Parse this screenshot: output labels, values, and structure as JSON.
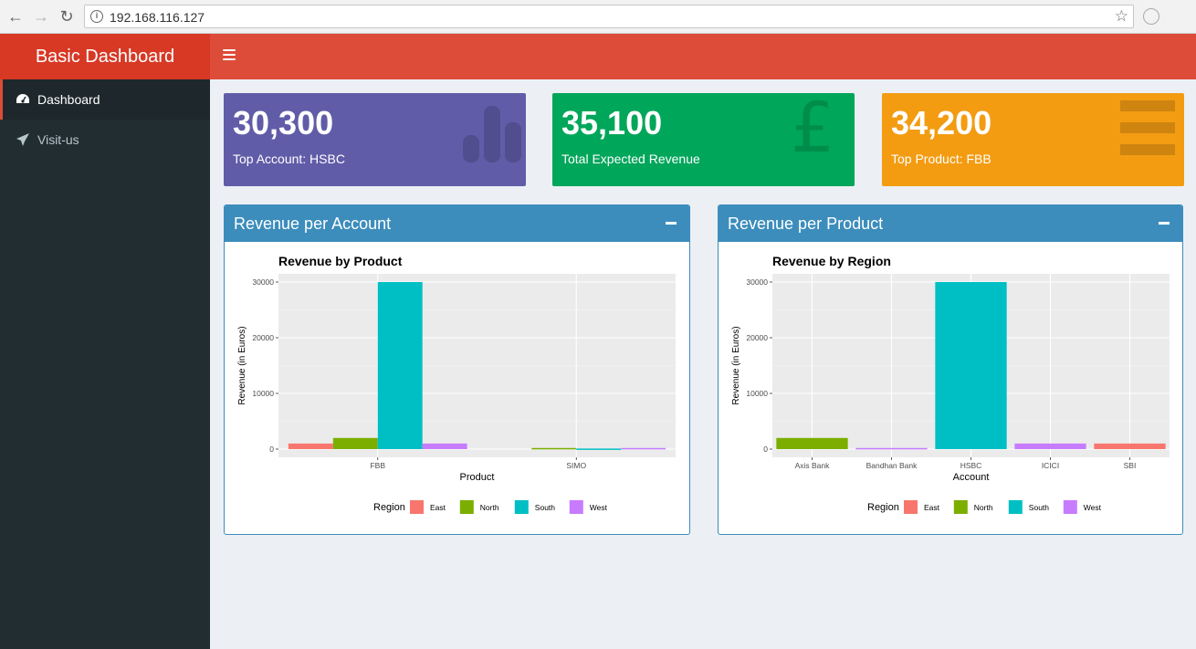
{
  "browser": {
    "url": "192.168.116.127"
  },
  "app": {
    "title": "Basic Dashboard"
  },
  "sidebar": {
    "items": [
      {
        "label": "Dashboard",
        "icon": "dashboard-icon",
        "active": true
      },
      {
        "label": "Visit-us",
        "icon": "paper-plane-icon",
        "active": false
      }
    ]
  },
  "value_boxes": [
    {
      "value": "30,300",
      "subtitle": "Top Account: HSBC",
      "color": "#605ca8",
      "icon": "bar-chart-icon"
    },
    {
      "value": "35,100",
      "subtitle": "Total Expected Revenue",
      "color": "#00a65a",
      "icon": "pound-icon"
    },
    {
      "value": "34,200",
      "subtitle": "Top Product: FBB",
      "color": "#f39c12",
      "icon": "menu-icon"
    }
  ],
  "panels": [
    {
      "title": "Revenue per Account"
    },
    {
      "title": "Revenue per Product"
    }
  ],
  "colors": {
    "East": "#f8766d",
    "North": "#7cae00",
    "South": "#00bfc4",
    "West": "#c77cff"
  },
  "chart_data": [
    {
      "type": "bar",
      "title": "Revenue by Product",
      "xlabel": "Product",
      "ylabel": "Revenue (in Euros)",
      "ylim": [
        0,
        30000
      ],
      "yticks": [
        0,
        10000,
        20000,
        30000
      ],
      "categories": [
        "FBB",
        "SIMO"
      ],
      "legend_title": "Region",
      "legend_position": "bottom",
      "series": [
        {
          "name": "East",
          "values": [
            1000,
            null
          ]
        },
        {
          "name": "North",
          "values": [
            2000,
            200
          ]
        },
        {
          "name": "South",
          "values": [
            30000,
            100
          ]
        },
        {
          "name": "West",
          "values": [
            1000,
            200
          ]
        }
      ]
    },
    {
      "type": "bar",
      "title": "Revenue by Region",
      "xlabel": "Account",
      "ylabel": "Revenue (in Euros)",
      "ylim": [
        0,
        30000
      ],
      "yticks": [
        0,
        10000,
        20000,
        30000
      ],
      "categories": [
        "Axis Bank",
        "Bandhan Bank",
        "HSBC",
        "ICICI",
        "SBI"
      ],
      "legend_title": "Region",
      "legend_position": "bottom",
      "series": [
        {
          "name": "North",
          "values": [
            2000,
            null,
            null,
            null,
            null
          ]
        },
        {
          "name": "West",
          "values": [
            null,
            200,
            null,
            1000,
            null
          ]
        },
        {
          "name": "South",
          "values": [
            null,
            null,
            30000,
            null,
            null
          ]
        },
        {
          "name": "East",
          "values": [
            null,
            null,
            null,
            null,
            1000
          ]
        }
      ],
      "legend_entries": [
        "East",
        "North",
        "South",
        "West"
      ]
    }
  ]
}
